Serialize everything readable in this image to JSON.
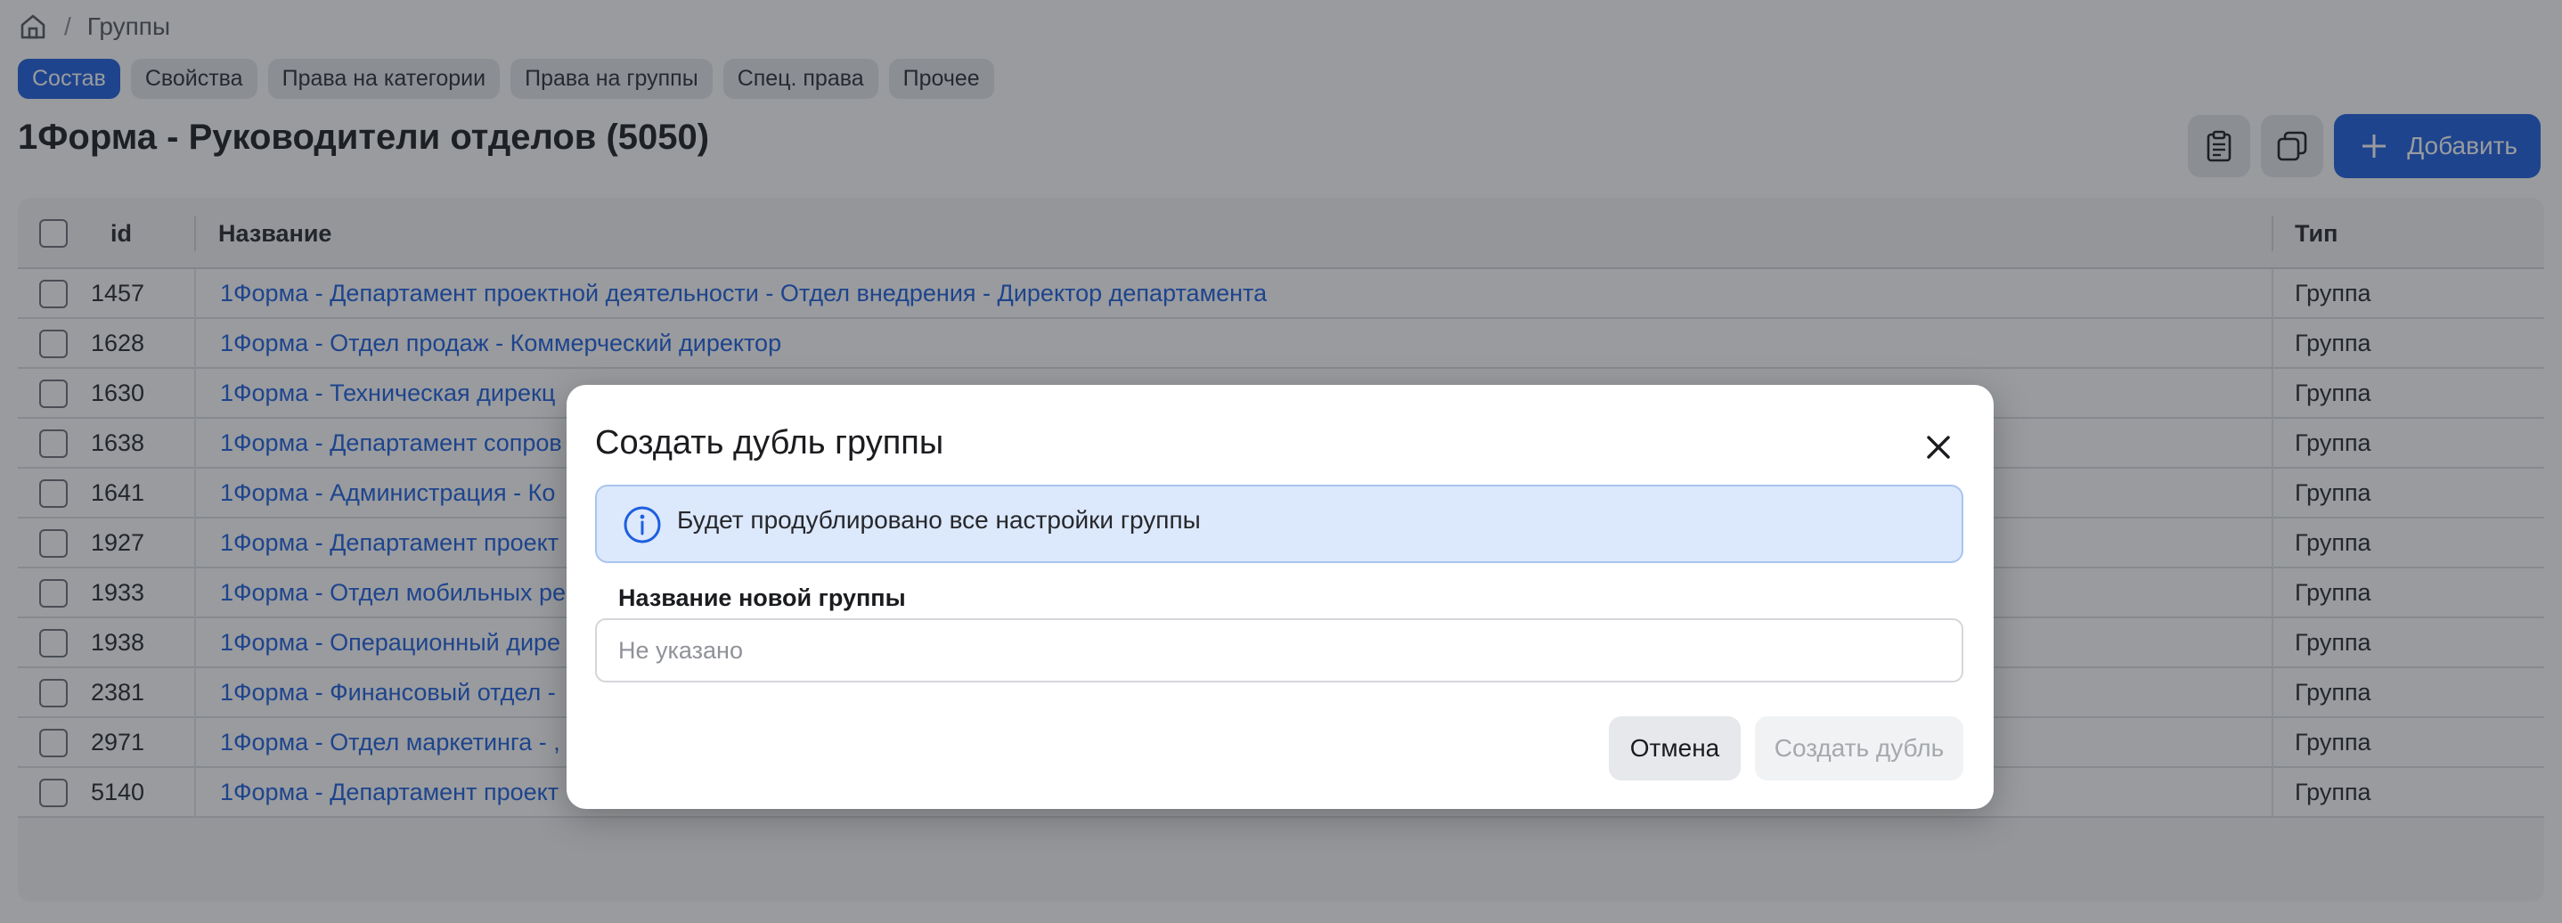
{
  "breadcrumb": {
    "home_icon": "home-icon",
    "separator": "/",
    "current": "Группы"
  },
  "tabs": [
    {
      "label": "Состав",
      "active": true
    },
    {
      "label": "Свойства",
      "active": false
    },
    {
      "label": "Права на категории",
      "active": false
    },
    {
      "label": "Права на группы",
      "active": false
    },
    {
      "label": "Спец. права",
      "active": false
    },
    {
      "label": "Прочее",
      "active": false
    }
  ],
  "page": {
    "title": "1Форма - Руководители отделов (5050)"
  },
  "toolbar": {
    "clipboard_icon": "clipboard-icon",
    "copy_icon": "copy-icon",
    "add_label": "Добавить"
  },
  "table": {
    "headers": {
      "id": "id",
      "name": "Название",
      "type": "Тип"
    },
    "rows": [
      {
        "id": "1457",
        "name": "1Форма - Департамент проектной деятельности - Отдел внедрения - Директор департамента",
        "type": "Группа"
      },
      {
        "id": "1628",
        "name": "1Форма - Отдел продаж - Коммерческий директор",
        "type": "Группа"
      },
      {
        "id": "1630",
        "name": "1Форма - Техническая дирекц",
        "type": "Группа"
      },
      {
        "id": "1638",
        "name": "1Форма - Департамент сопров",
        "type": "Группа"
      },
      {
        "id": "1641",
        "name": "1Форма - Администрация - Ко",
        "type": "Группа"
      },
      {
        "id": "1927",
        "name": "1Форма - Департамент проект",
        "type": "Группа"
      },
      {
        "id": "1933",
        "name": "1Форма - Отдел мобильных ре",
        "type": "Группа"
      },
      {
        "id": "1938",
        "name": "1Форма - Операционный дире",
        "type": "Группа"
      },
      {
        "id": "2381",
        "name": "1Форма - Финансовый отдел -",
        "type": "Группа"
      },
      {
        "id": "2971",
        "name": "1Форма - Отдел маркетинга - ,",
        "type": "Группа"
      },
      {
        "id": "5140",
        "name": "1Форма - Департамент проект",
        "type": "Группа"
      }
    ]
  },
  "modal": {
    "title": "Создать дубль группы",
    "alert_text": "Будет продублировано все настройки группы",
    "field_label": "Название новой группы",
    "field_value": "",
    "field_placeholder": "Не указано",
    "cancel_label": "Отмена",
    "create_label": "Создать дубль"
  },
  "colors": {
    "accent": "#1d5fe0",
    "link": "#1d5fe0",
    "alert_bg": "#dce8fb",
    "overlay": "rgba(33,37,43,0.46)"
  }
}
